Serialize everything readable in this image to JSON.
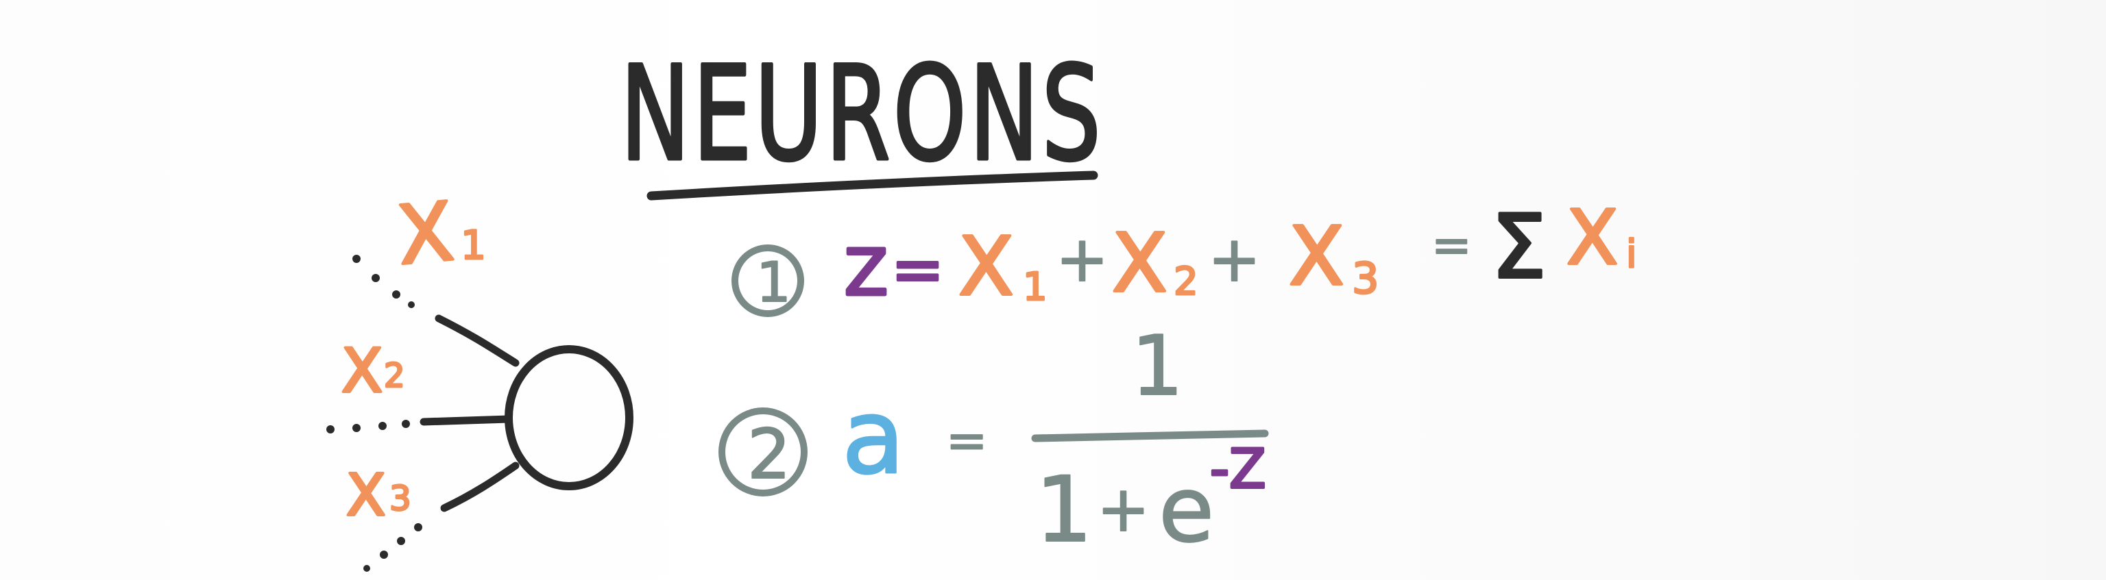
{
  "title": "NEURONS",
  "neuron": {
    "inputs": [
      {
        "label": "X",
        "sub": "1"
      },
      {
        "label": "X",
        "sub": "2"
      },
      {
        "label": "X",
        "sub": "3"
      }
    ]
  },
  "equations": [
    {
      "number": "1",
      "lhs": "Z",
      "equals": "=",
      "terms": [
        {
          "label": "X",
          "sub": "1"
        },
        {
          "label": "X",
          "sub": "2"
        },
        {
          "label": "X",
          "sub": "3"
        }
      ],
      "plus": "+",
      "sum_symbol": "Σ",
      "sum_term": {
        "label": "X",
        "sub": "i"
      }
    },
    {
      "number": "2",
      "lhs": "a",
      "equals": "=",
      "numerator": "1",
      "denominator": {
        "one": "1",
        "plus": "+",
        "base": "e",
        "exponent": "-Z"
      }
    }
  ],
  "colors": {
    "ink": "#2b2b2b",
    "orange": "#f0925a",
    "purple": "#7b3a8e",
    "blue": "#5cb1e0",
    "gray": "#7a8a86"
  }
}
